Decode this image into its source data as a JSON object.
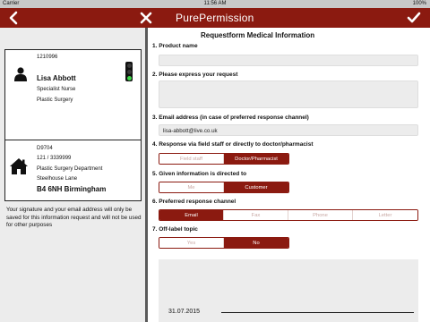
{
  "status_bar": {
    "carrier": "Carrier",
    "time": "11:56 AM",
    "battery": "100%"
  },
  "nav": {
    "title": "PurePermission",
    "back_icon": "chevron-left-icon",
    "close_icon": "close-icon",
    "confirm_icon": "checkmark-icon"
  },
  "colors": {
    "accent": "#8b1a10",
    "pane_bg": "#ececec",
    "field_bg": "#ececec"
  },
  "person_card": {
    "id": "1210996",
    "name": "Lisa Abbott",
    "role": "Specialist Nurse",
    "department": "Plastic Surgery",
    "traffic_light": "green"
  },
  "org_card": {
    "id": "D9704",
    "phone": "121 / 3339999",
    "department": "Plastic Surgery Department",
    "street": "Steelhouse Lane",
    "postcode_city": "B4 6NH Birmingham"
  },
  "privacy_note": "Your signature and your email address will only be saved for this information request and will not be used for other purposes",
  "form": {
    "title": "Requestform Medical Information",
    "q1": {
      "label": "1. Product name",
      "value": ""
    },
    "q2": {
      "label": "2. Please express your request",
      "value": ""
    },
    "q3": {
      "label": "3. Email address (in case of preferred response channel)",
      "value": "lisa-abbott@live.co.uk"
    },
    "q4": {
      "label": "4. Response via field staff or directly to doctor/pharmacist",
      "options": [
        "Field staff",
        "Doctor/Pharmacist"
      ],
      "selected": "Doctor/Pharmacist"
    },
    "q5": {
      "label": "5. Given information is directed to",
      "options": [
        "Me",
        "Customer"
      ],
      "selected": "Customer"
    },
    "q6": {
      "label": "6. Preferred response channel",
      "options": [
        "Email",
        "Fax",
        "Phone",
        "Letter"
      ],
      "selected": "Email"
    },
    "q7": {
      "label": "7. Off-label topic",
      "options": [
        "Yes",
        "No"
      ],
      "selected": "No"
    },
    "signature_date": "31.07.2015"
  }
}
